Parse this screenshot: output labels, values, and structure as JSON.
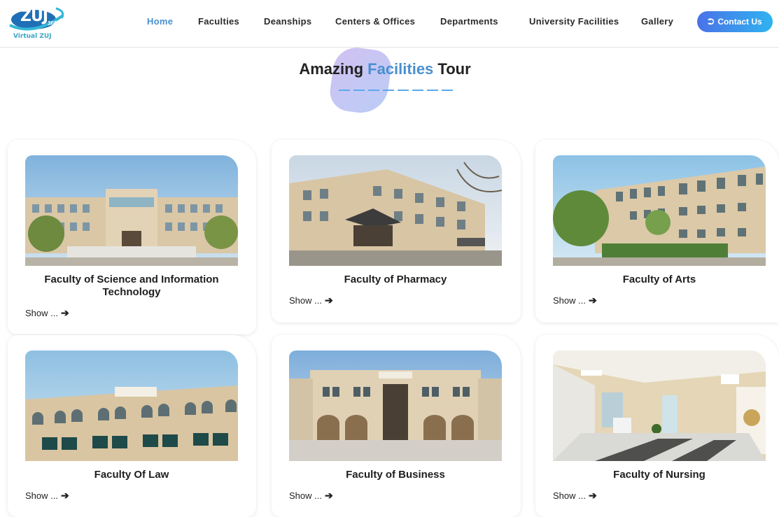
{
  "logo": {
    "main": "ZUJ",
    "badge": "360°",
    "subtitle": "Virtual ZUJ"
  },
  "nav": {
    "items": [
      {
        "label": "Home",
        "active": true
      },
      {
        "label": "Faculties",
        "active": false
      },
      {
        "label": "Deanships",
        "active": false
      },
      {
        "label": "Centers & Offices",
        "active": false
      },
      {
        "label": "Departments",
        "active": false
      },
      {
        "label": "University Facilities",
        "active": false
      },
      {
        "label": "Gallery",
        "active": false
      }
    ],
    "contact_label": "Contact Us",
    "contact_icon": "sign-in-icon"
  },
  "section": {
    "title_before": "Amazing ",
    "title_highlight": "Facilities",
    "title_after": " Tour"
  },
  "cards": [
    {
      "title": "Faculty of Science and Information Technology",
      "link": "Show ...",
      "photo": "building-photo"
    },
    {
      "title": "Faculty of Pharmacy",
      "link": "Show ...",
      "photo": "building-photo"
    },
    {
      "title": "Faculty of Arts",
      "link": "Show ...",
      "photo": "building-photo"
    },
    {
      "title": "Faculty Of Law",
      "link": "Show ...",
      "photo": "building-photo"
    },
    {
      "title": "Faculty of Business",
      "link": "Show ...",
      "photo": "building-photo"
    },
    {
      "title": "Faculty of Nursing",
      "link": "Show ...",
      "photo": "interior-photo"
    }
  ],
  "colors": {
    "accent": "#4a8fd0",
    "button_gradient_start": "#4a72e8",
    "button_gradient_end": "#2fb3f0",
    "stone": "#d9c7a6"
  }
}
